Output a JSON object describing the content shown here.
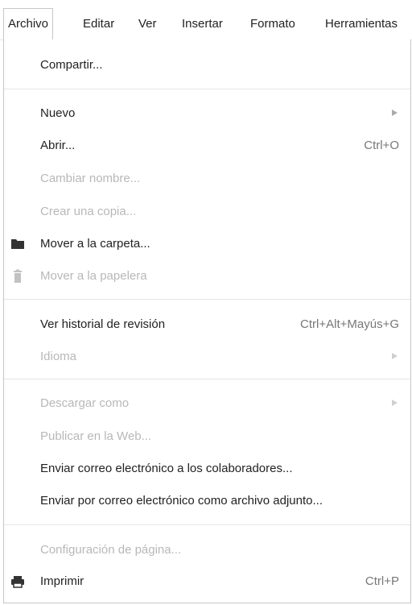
{
  "menubar": {
    "items": [
      {
        "label": "Archivo"
      },
      {
        "label": "Editar"
      },
      {
        "label": "Ver"
      },
      {
        "label": "Insertar"
      },
      {
        "label": "Formato"
      },
      {
        "label": "Herramientas"
      }
    ],
    "active": "Archivo"
  },
  "file_menu": {
    "share": {
      "label": "Compartir..."
    },
    "new": {
      "label": "Nuevo"
    },
    "open": {
      "label": "Abrir...",
      "shortcut": "Ctrl+O"
    },
    "rename": {
      "label": "Cambiar nombre..."
    },
    "copy": {
      "label": "Crear una copia..."
    },
    "move_folder": {
      "label": "Mover a la carpeta...",
      "icon": "folder-icon"
    },
    "trash": {
      "label": "Mover a la papelera",
      "icon": "trash-icon"
    },
    "history": {
      "label": "Ver historial de revisión",
      "shortcut": "Ctrl+Alt+Mayús+G"
    },
    "language": {
      "label": "Idioma"
    },
    "download": {
      "label": "Descargar como"
    },
    "publish": {
      "label": "Publicar en la Web..."
    },
    "email_collab": {
      "label": "Enviar correo electrónico a los colaboradores..."
    },
    "email_attach": {
      "label": "Enviar por correo electrónico como archivo adjunto..."
    },
    "page_setup": {
      "label": "Configuración de página..."
    },
    "print": {
      "label": "Imprimir",
      "shortcut": "Ctrl+P",
      "icon": "printer-icon"
    }
  },
  "colors": {
    "text": "#222222",
    "disabled": "#b8b8b8",
    "border": "#c6c6c6"
  }
}
